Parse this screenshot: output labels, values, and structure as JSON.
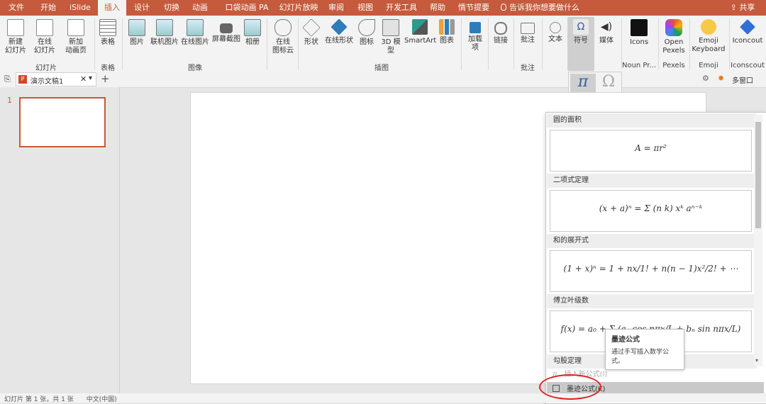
{
  "tabs": [
    "文件",
    "开始",
    "iSlide",
    "插入",
    "设计",
    "切换",
    "动画",
    "口袋动画 PA",
    "幻灯片放映",
    "审阅",
    "视图",
    "开发工具",
    "帮助",
    "情节提要"
  ],
  "tell_me": "告诉我你想要做什么",
  "share": "共享",
  "ribbon": {
    "new_slide": "新建\n幻灯片",
    "online_slide": "在线\n幻灯片",
    "new_anim_page": "新加\n动画页",
    "table": "表格",
    "picture": "图片",
    "online_picture2": "联机图片",
    "online_picture": "在线图片",
    "screenshot": "屏幕截图",
    "album": "相册",
    "online_icon_cloud": "在线\n图标云",
    "shapes": "形状",
    "online_shapes": "在线形状",
    "icons": "图标",
    "model_3d": "3D 模\n型",
    "smartart": "SmartArt",
    "chart": "图表",
    "addins": "加载\n项",
    "link": "链接",
    "comment": "批注",
    "text": "文本",
    "symbol": "符号",
    "media": "媒体",
    "icons_addin": "Icons",
    "open_pexels": "Open\nPexels",
    "emoji_keyboard": "Emoji\nKeyboard",
    "iconscout": "Iconcout",
    "groups": {
      "slides": "幻灯片",
      "tables": "表格",
      "images": "图像",
      "illustrations": "插图",
      "comments": "批注",
      "noun": "Noun Pr...",
      "pexels": "Pexels",
      "emoji": "Emoji",
      "iconscout": "Iconscout"
    }
  },
  "symbol_sub": {
    "formula": "公式",
    "symbol": "符号"
  },
  "doc_tab": "演示文稿1",
  "doc_right": "多窗口",
  "slide_number": "1",
  "equations": [
    {
      "title": "圆的面积",
      "formula": "A = πr²"
    },
    {
      "title": "二项式定理",
      "formula": "(x + a)ⁿ = Σ (n k) xᵏ aⁿ⁻ᵏ"
    },
    {
      "title": "和的展开式",
      "formula": "(1 + x)ⁿ = 1 + nx/1! + n(n − 1)x²/2! + ⋯"
    },
    {
      "title": "傅立叶级数",
      "formula": "f(x) = a₀ + Σ (aₙ cos nπx/L + bₙ sin nπx/L)"
    },
    {
      "title": "勾股定理",
      "formula": ""
    }
  ],
  "menu": {
    "insert_new": "插入新公式(I)",
    "ink_formula": "墨迹公式(K)"
  },
  "tooltip": {
    "title": "墨迹公式",
    "desc": "通过手写插入数学公式。"
  },
  "status": "幻灯片 第 1 张，共 1 张　　中文(中国)",
  "colors": {
    "accent": "#c55a3c",
    "annotation": "#d22222"
  }
}
